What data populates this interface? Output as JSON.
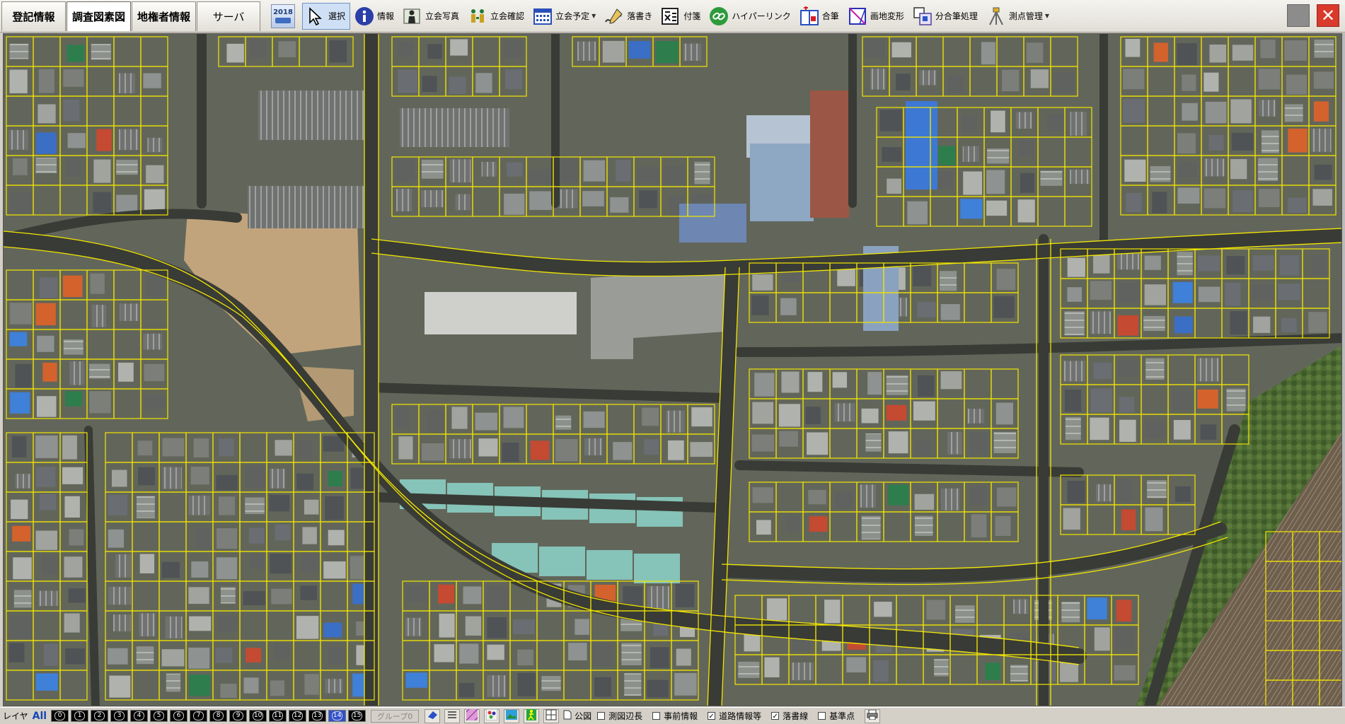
{
  "tabs": [
    {
      "label": "登記情報",
      "active": false
    },
    {
      "label": "調査図素図",
      "active": true
    },
    {
      "label": "地権者情報",
      "active": false
    },
    {
      "label": "サーバ",
      "active": false
    }
  ],
  "year_button": {
    "label": "2018"
  },
  "tools": [
    {
      "label": "選択",
      "icon": "cursor-arrow-icon",
      "active": true,
      "dropdown": false
    },
    {
      "label": "情報",
      "icon": "info-icon",
      "active": false,
      "dropdown": false
    },
    {
      "label": "立会写真",
      "icon": "person-photo-icon",
      "active": false,
      "dropdown": false
    },
    {
      "label": "立会確認",
      "icon": "people-confirm-icon",
      "active": false,
      "dropdown": false
    },
    {
      "label": "立会予定",
      "icon": "calendar-icon",
      "active": false,
      "dropdown": true
    },
    {
      "label": "落書き",
      "icon": "scribble-pen-icon",
      "active": false,
      "dropdown": false
    },
    {
      "label": "付箋",
      "icon": "memo-icon",
      "active": false,
      "dropdown": false
    },
    {
      "label": "ハイパーリンク",
      "icon": "link-icon",
      "active": false,
      "dropdown": false
    },
    {
      "label": "合筆",
      "icon": "merge-plot-icon",
      "active": false,
      "dropdown": false
    },
    {
      "label": "画地変形",
      "icon": "transform-plot-icon",
      "active": false,
      "dropdown": false
    },
    {
      "label": "分合筆処理",
      "icon": "split-merge-icon",
      "active": false,
      "dropdown": false
    },
    {
      "label": "測点管理",
      "icon": "survey-tripod-icon",
      "active": false,
      "dropdown": true
    }
  ],
  "statusbar": {
    "layer_label": "レイヤ",
    "all_label": "All",
    "layers": [
      "0",
      "1",
      "2",
      "3",
      "4",
      "5",
      "6",
      "7",
      "8",
      "9",
      "10",
      "11",
      "12",
      "13",
      "14",
      "15"
    ],
    "selected_layer": "14",
    "group_label": "グループ0",
    "kouzu_label": "公図",
    "checkboxes": [
      {
        "label": "測図辺長",
        "checked": false
      },
      {
        "label": "事前情報",
        "checked": false
      },
      {
        "label": "道路情報等",
        "checked": true
      },
      {
        "label": "落書線",
        "checked": true
      },
      {
        "label": "基準点",
        "checked": false
      }
    ]
  },
  "colors": {
    "parcel_line": "#f2e600",
    "road": "#3b3d38",
    "selected_layer": "#3050d0",
    "accent": "#1846b4"
  }
}
